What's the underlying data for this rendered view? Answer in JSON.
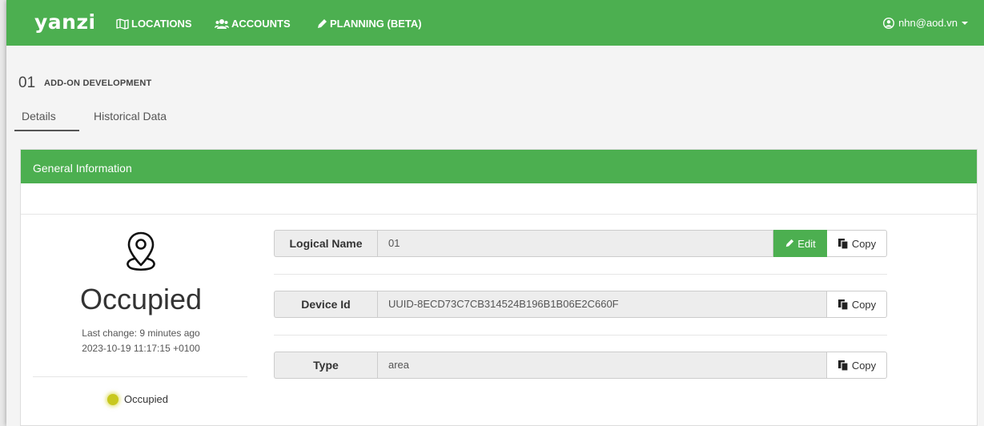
{
  "navbar": {
    "brand": "yanzi",
    "locations_label": "LOCATIONS",
    "accounts_label": "ACCOUNTS",
    "planning_label": "PLANNING (BETA)",
    "user_email": "nhn@aod.vn",
    "color": "#4caf50"
  },
  "header": {
    "code": "01",
    "title": "ADD-ON DEVELOPMENT",
    "tabs": [
      {
        "label": "Details",
        "active": true
      },
      {
        "label": "Historical Data",
        "active": false
      }
    ]
  },
  "panel": {
    "title": "General Information",
    "status": {
      "value": "Occupied",
      "last_change": "Last change: 9 minutes ago",
      "timestamp": "2023-10-19 11:17:15 +0100",
      "legend_label": "Occupied",
      "legend_color": "#c8c81e"
    },
    "fields": [
      {
        "label": "Logical Name",
        "value": "01",
        "editable": true
      },
      {
        "label": "Device Id",
        "value": "UUID-8ECD73C7CB314524B196B1B06E2C660F",
        "editable": false
      },
      {
        "label": "Type",
        "value": "area",
        "editable": false
      }
    ],
    "edit_label": "Edit",
    "copy_label": "Copy"
  }
}
